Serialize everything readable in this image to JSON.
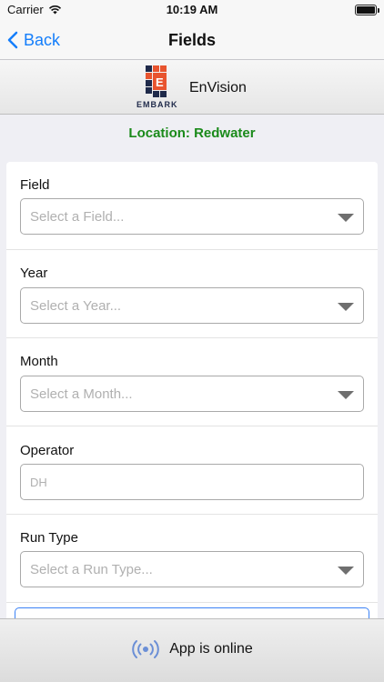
{
  "status_bar": {
    "carrier": "Carrier",
    "time": "10:19 AM"
  },
  "nav": {
    "back_label": "Back",
    "title": "Fields"
  },
  "brand": {
    "logo_text": "EMBARK",
    "name": "EnVision",
    "logo_colors": {
      "navy": "#1f2a4a",
      "orange": "#e8542f"
    }
  },
  "location": {
    "label": "Location: Redwater",
    "color": "#1a8a1a"
  },
  "form": {
    "field": {
      "label": "Field",
      "placeholder": "Select a Field..."
    },
    "year": {
      "label": "Year",
      "placeholder": "Select a Year..."
    },
    "month": {
      "label": "Month",
      "placeholder": "Select a Month..."
    },
    "operator": {
      "label": "Operator",
      "placeholder": "DH"
    },
    "run_type": {
      "label": "Run Type",
      "placeholder": "Select a Run Type..."
    }
  },
  "footer": {
    "status_text": "App is online",
    "icon": "broadcast-icon",
    "icon_color": "#6b8fd6"
  }
}
